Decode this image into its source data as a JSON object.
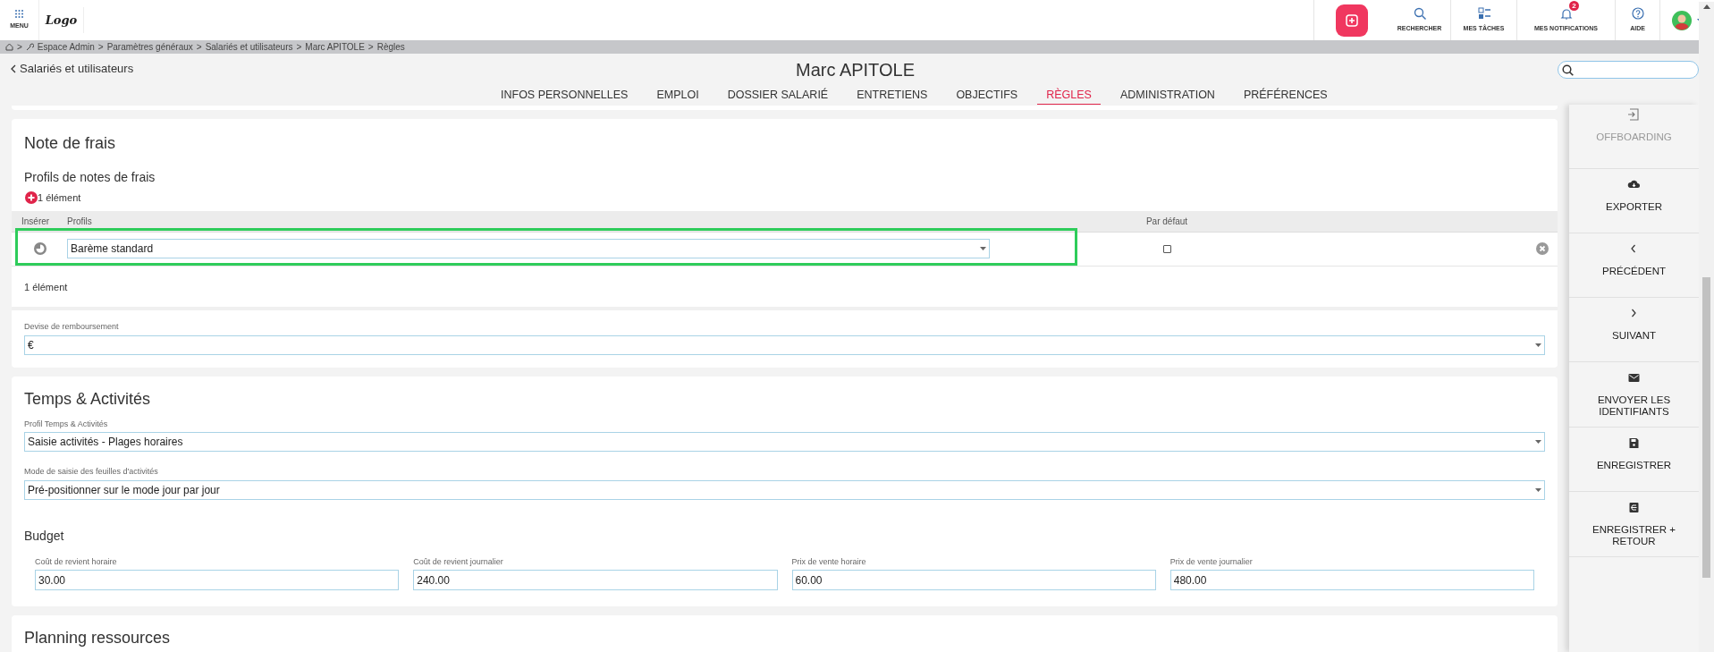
{
  "topbar": {
    "menu_label": "MENU",
    "logo": "Logo",
    "items": [
      {
        "label": "RECHERCHER"
      },
      {
        "label": "MES TÂCHES"
      },
      {
        "label": "MES NOTIFICATIONS",
        "badge": "2"
      },
      {
        "label": "AIDE"
      }
    ]
  },
  "breadcrumb": [
    "Espace Admin",
    "Paramètres généraux",
    "Salariés et utilisateurs",
    "Marc APITOLE",
    "Règles"
  ],
  "breadcrumb_separator": ">",
  "back_link": "Salariés et utilisateurs",
  "title": "Marc APITOLE",
  "tabs": [
    {
      "label": "INFOS PERSONNELLES",
      "selected": false
    },
    {
      "label": "EMPLOI",
      "selected": false
    },
    {
      "label": "DOSSIER SALARIÉ",
      "selected": false
    },
    {
      "label": "ENTRETIENS",
      "selected": false
    },
    {
      "label": "OBJECTIFS",
      "selected": false
    },
    {
      "label": "RÈGLES",
      "selected": true
    },
    {
      "label": "ADMINISTRATION",
      "selected": false
    },
    {
      "label": "PRÉFÉRENCES",
      "selected": false
    }
  ],
  "note_de_frais": {
    "title": "Note de frais",
    "subtitle": "Profils de notes de frais",
    "count_top": "1 élément",
    "columns": [
      "Insérer",
      "Profils",
      "Par défaut"
    ],
    "rows": [
      {
        "profile": "Barème standard",
        "default": false,
        "highlighted": true
      }
    ],
    "count_bottom": "1 élément",
    "currency_label": "Devise de remboursement",
    "currency_value": "€"
  },
  "temps": {
    "title": "Temps & Activités",
    "fields": [
      {
        "label": "Profil Temps & Activités",
        "value": "Saisie activités - Plages horaires"
      },
      {
        "label": "Mode de saisie des feuilles d'activités",
        "value": "Pré-positionner sur le mode jour par jour"
      }
    ],
    "budget_title": "Budget",
    "budget": [
      {
        "label": "Coût de revient horaire",
        "value": "30.00"
      },
      {
        "label": "Coût de revient journalier",
        "value": "240.00"
      },
      {
        "label": "Prix de vente horaire",
        "value": "60.00"
      },
      {
        "label": "Prix de vente journalier",
        "value": "480.00"
      }
    ]
  },
  "planning": {
    "title": "Planning ressources"
  },
  "actions": [
    {
      "label": "OFFBOARDING",
      "disabled": true
    },
    {
      "label": "EXPORTER",
      "disabled": false
    },
    {
      "label": "PRÉCÉDENT",
      "disabled": false
    },
    {
      "label": "SUIVANT",
      "disabled": false
    },
    {
      "label": "ENVOYER LES IDENTIFIANTS",
      "disabled": false
    },
    {
      "label": "ENREGISTRER",
      "disabled": false
    },
    {
      "label": "ENREGISTRER + RETOUR",
      "disabled": false
    }
  ]
}
